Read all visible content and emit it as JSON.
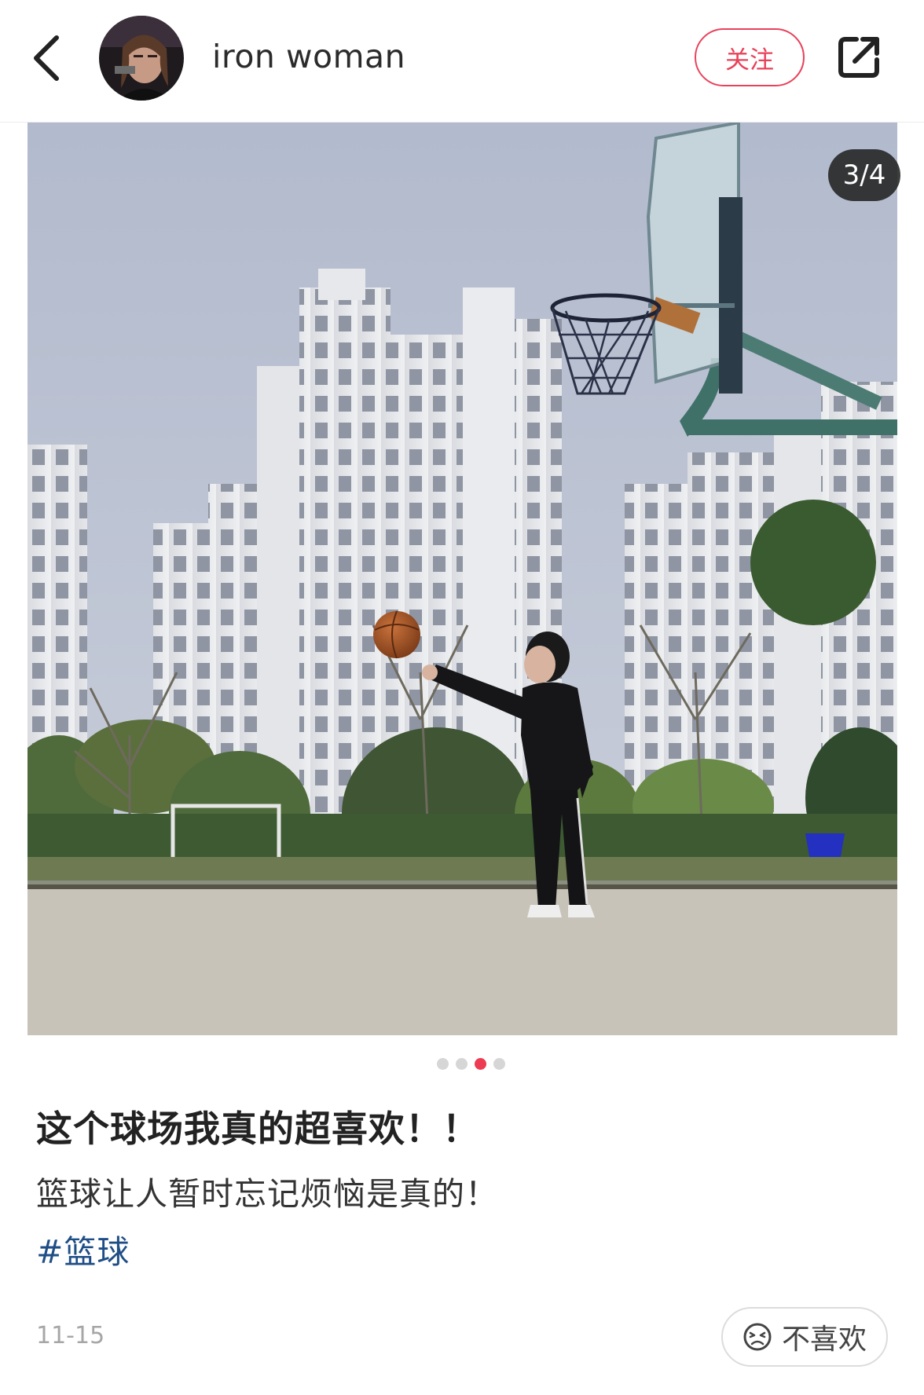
{
  "header": {
    "back_icon": "chevron-left-icon",
    "author_name": "iron woman",
    "follow_label": "关注",
    "share_icon": "share-external-icon"
  },
  "post": {
    "image_counter": "3/4",
    "carousel": {
      "total": 4,
      "active_index": 2
    },
    "title": "这个球场我真的超喜欢！！",
    "body": "篮球让人暂时忘记烦恼是真的！",
    "hashtag": "#篮球",
    "date": "11-15",
    "dislike_label": "不喜欢",
    "dislike_icon": "unhappy-face-icon"
  },
  "colors": {
    "accent": "#e8425a",
    "active_dot": "#ec3b52",
    "hashtag": "#1f4e86",
    "sky": "#b9c1d3"
  }
}
